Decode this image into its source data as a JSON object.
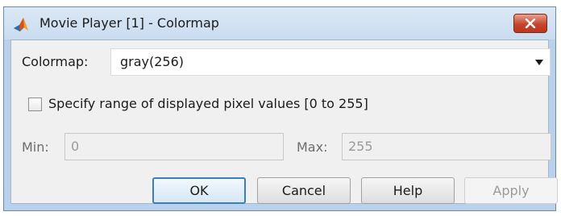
{
  "window": {
    "title": "Movie Player [1] - Colormap"
  },
  "colormap": {
    "label": "Colormap:",
    "selected": "gray(256)"
  },
  "range": {
    "checkbox_label": "Specify range of displayed pixel values [0 to 255]",
    "checked": false,
    "min_label": "Min:",
    "min_value": "0",
    "max_label": "Max:",
    "max_value": "255"
  },
  "buttons": {
    "ok": "OK",
    "cancel": "Cancel",
    "help": "Help",
    "apply": "Apply"
  },
  "icons": {
    "app": "matlab-logo-icon",
    "close": "close-icon",
    "dropdown": "chevron-down-icon"
  },
  "colors": {
    "accent": "#3c7fb1",
    "close": "#c7452c"
  }
}
